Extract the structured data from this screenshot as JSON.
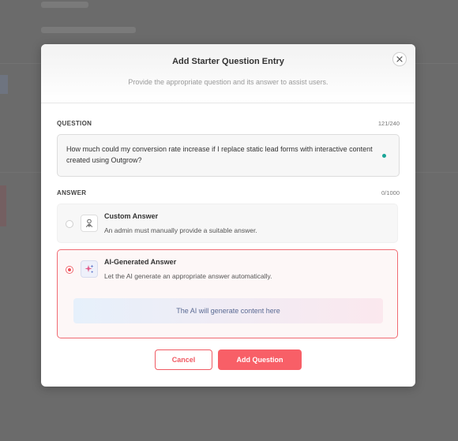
{
  "modal": {
    "title": "Add Starter Question Entry",
    "subtitle": "Provide the appropriate question and its answer to assist users.",
    "close_icon": "close-icon"
  },
  "question": {
    "label": "QUESTION",
    "counter": "121/240",
    "value": "How much could my conversion rate increase if I replace static lead forms with interactive content created using Outgrow?",
    "status_color": "#1aa597"
  },
  "answer": {
    "label": "ANSWER",
    "counter": "0/1000",
    "options": [
      {
        "title": "Custom Answer",
        "description": "An admin must manually provide a suitable answer.",
        "icon": "user-icon",
        "selected": false
      },
      {
        "title": "AI-Generated Answer",
        "description": "Let the AI generate an appropriate answer automatically.",
        "icon": "sparkle-icon",
        "selected": true,
        "preview": "The AI will generate content here"
      }
    ]
  },
  "actions": {
    "cancel": "Cancel",
    "add": "Add Question"
  },
  "colors": {
    "accent": "#f85f67",
    "overlay": "#6b6b6b"
  }
}
